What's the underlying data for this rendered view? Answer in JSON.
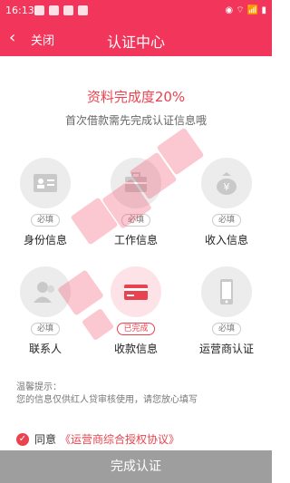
{
  "status_bar": {
    "time": "16:13",
    "indicators": "◉ ⌔ 📶 ▮"
  },
  "nav": {
    "back_icon": "chevron-left",
    "close_label": "关闭",
    "title": "认证中心"
  },
  "progress": {
    "title": "资料完成度20%",
    "subtitle": "首次借款需先完成认证信息哦"
  },
  "cards": [
    {
      "label": "身份信息",
      "status": "必填",
      "icon": "id-card"
    },
    {
      "label": "工作信息",
      "status": "必填",
      "icon": "briefcase"
    },
    {
      "label": "收入信息",
      "status": "必填",
      "icon": "money-bag"
    },
    {
      "label": "联系人",
      "status": "必填",
      "icon": "contact"
    },
    {
      "label": "收款信息",
      "status": "已完成",
      "icon": "bank-card"
    },
    {
      "label": "运营商认证",
      "status": "必填",
      "icon": "phone"
    }
  ],
  "tips": {
    "title": "温馨提示：",
    "body": "您的信息仅供红人贷审核使用，请您放心填写"
  },
  "agreement": {
    "prefix": "同意",
    "link": "《运营商综合授权协议》"
  },
  "submit_label": "完成认证",
  "colors": {
    "accent": "#f2355a",
    "text_accent": "#e8434f",
    "button_disabled": "#9e9e9e"
  }
}
